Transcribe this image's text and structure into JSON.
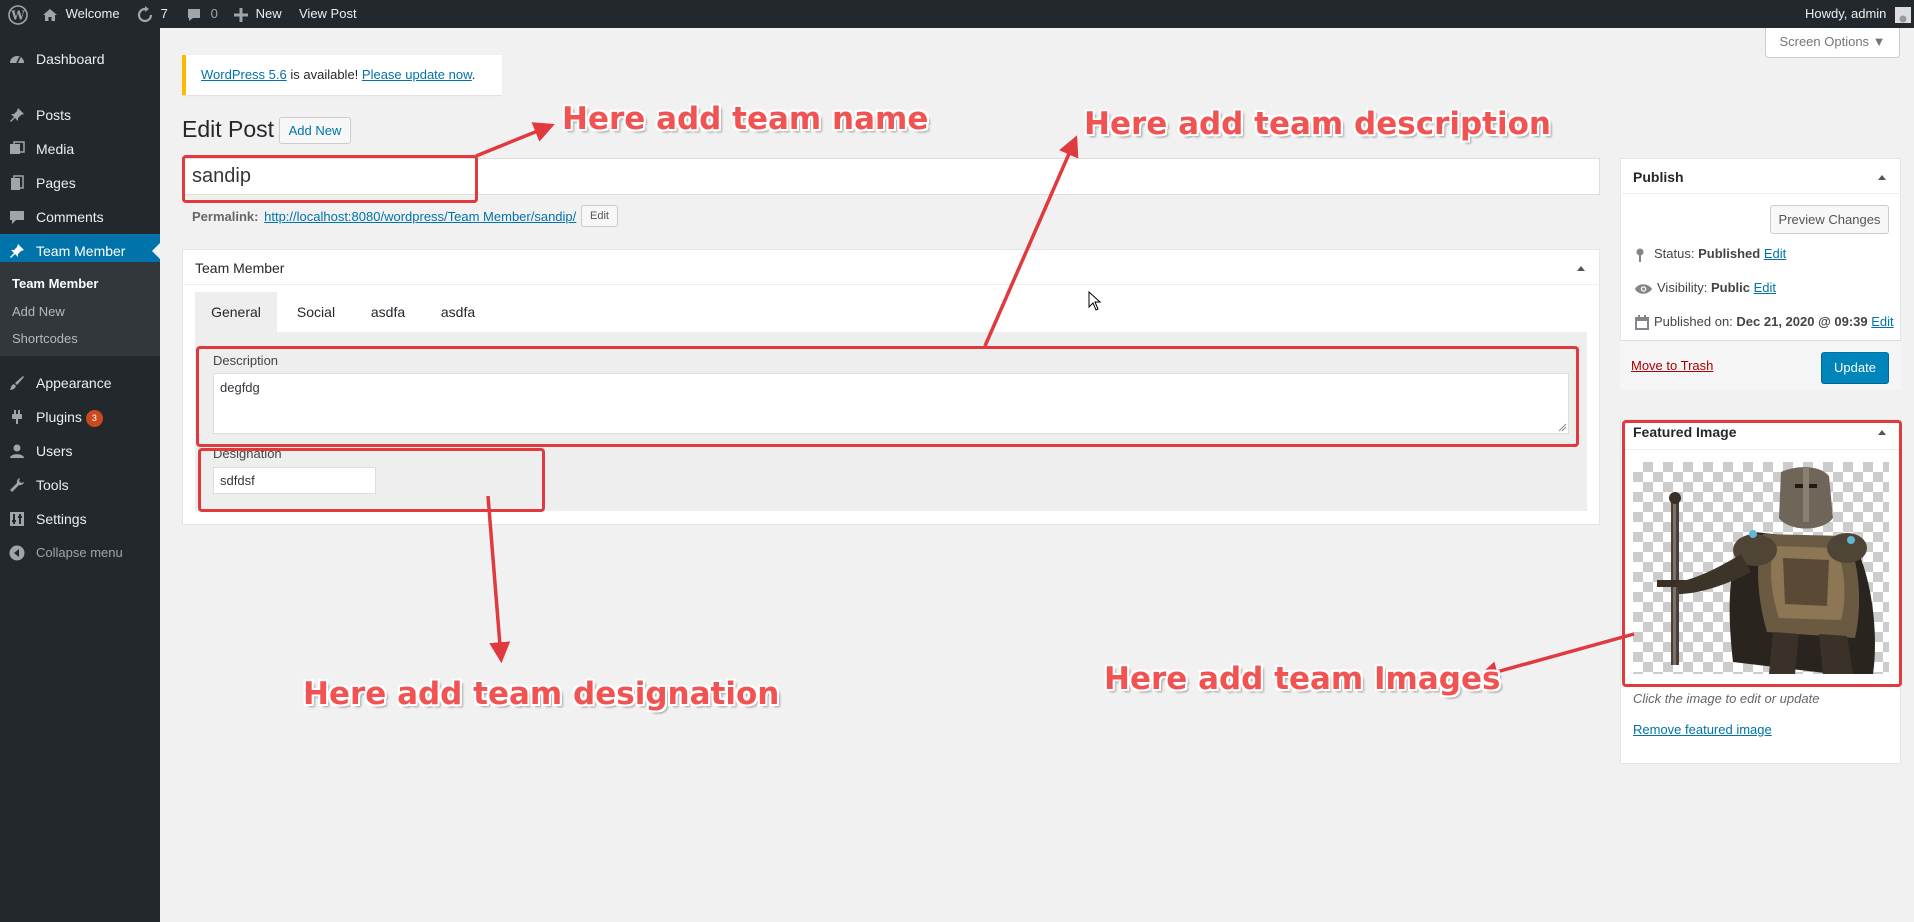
{
  "admin_bar": {
    "site_name": "Welcome",
    "updates_count": "7",
    "comments_count": "0",
    "new_label": "New",
    "view_post_label": "View Post",
    "howdy": "Howdy, admin"
  },
  "sidebar": {
    "items": [
      {
        "label": "Dashboard",
        "icon": "dashboard-icon"
      },
      {
        "label": "Posts",
        "icon": "pin-icon"
      },
      {
        "label": "Media",
        "icon": "media-icon"
      },
      {
        "label": "Pages",
        "icon": "pages-icon"
      },
      {
        "label": "Comments",
        "icon": "comment-icon"
      },
      {
        "label": "Team Member",
        "icon": "pin-icon"
      },
      {
        "label": "Appearance",
        "icon": "brush-icon"
      },
      {
        "label": "Plugins",
        "icon": "plug-icon",
        "badge": "3"
      },
      {
        "label": "Users",
        "icon": "user-icon"
      },
      {
        "label": "Tools",
        "icon": "wrench-icon"
      },
      {
        "label": "Settings",
        "icon": "settings-icon"
      },
      {
        "label": "Collapse menu",
        "icon": "collapse-icon"
      }
    ],
    "submenu": [
      "Team Member",
      "Add New",
      "Shortcodes"
    ]
  },
  "screen_options": "Screen Options ▼",
  "notice": {
    "link1": "WordPress 5.6",
    "text": " is available! ",
    "link2": "Please update now",
    "end": "."
  },
  "page_title": "Edit Post",
  "add_new_label": "Add New",
  "post_title": "sandip",
  "permalink": {
    "label": "Permalink:",
    "url": "http://localhost:8080/wordpress/Team Member/sandip/",
    "edit_label": "Edit"
  },
  "team_box": {
    "title": "Team Member",
    "tabs": [
      "General",
      "Social",
      "asdfa",
      "asdfa"
    ],
    "description_label": "Description",
    "description_value": "degfdg",
    "designation_label": "Designation",
    "designation_value": "sdfdsf"
  },
  "publish": {
    "title": "Publish",
    "preview_label": "Preview Changes",
    "status_label": "Status:",
    "status_value": "Published",
    "visibility_label": "Visibility:",
    "visibility_value": "Public",
    "published_label": "Published on:",
    "published_value": "Dec 21, 2020 @ 09:39",
    "edit_label": "Edit",
    "trash_label": "Move to Trash",
    "update_label": "Update"
  },
  "featured": {
    "title": "Featured Image",
    "hint": "Click the image to edit or update",
    "remove_label": "Remove featured image"
  },
  "annotations": {
    "name": "Here add team name",
    "description": "Here add team description",
    "designation": "Here add team designation",
    "images": "Here add team Images"
  },
  "colors": {
    "accent": "#0073aa",
    "annotation_red": "#e0393e",
    "sidebar_bg": "#23282d"
  }
}
